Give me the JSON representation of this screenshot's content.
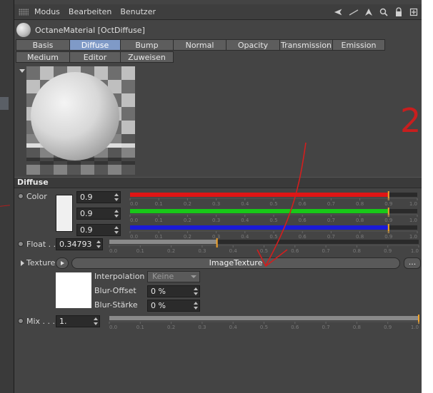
{
  "menubar": {
    "items": [
      "Modus",
      "Bearbeiten",
      "Benutzer"
    ]
  },
  "material": {
    "title": "OctaneMaterial [OctDiffuse]"
  },
  "tabs_row1": [
    {
      "label": "Basis"
    },
    {
      "label": "Diffuse",
      "active": true
    },
    {
      "label": "Bump"
    },
    {
      "label": "Normal"
    },
    {
      "label": "Opacity"
    },
    {
      "label": "Transmission"
    },
    {
      "label": "Emission"
    }
  ],
  "tabs_row2": [
    {
      "label": "Medium"
    },
    {
      "label": "Editor"
    },
    {
      "label": "Zuweisen"
    }
  ],
  "section": {
    "title": "Diffuse"
  },
  "color": {
    "label": "Color",
    "channels": [
      {
        "value": "0.9",
        "level": 0.9,
        "fill": "#e01515"
      },
      {
        "value": "0.9",
        "level": 0.9,
        "fill": "#18c818"
      },
      {
        "value": "0.9",
        "level": 0.9,
        "fill": "#1a1ad6"
      }
    ]
  },
  "float": {
    "label": "Float . .",
    "value": "0.34793",
    "level": 0.34793
  },
  "texture": {
    "label": "Texture",
    "button": "ImageTexture",
    "more": "..."
  },
  "image_settings": {
    "interpolation_label": "Interpolation",
    "interpolation_value": "Keine",
    "blur_offset_label": "Blur-Offset",
    "blur_offset_value": "0 %",
    "blur_strength_label": "Blur-Stärke",
    "blur_strength_value": "0 %"
  },
  "mix": {
    "label": "Mix . . .",
    "value": "1.",
    "level": 1.0
  },
  "slider_ticks": [
    "0.0",
    "0.1",
    "0.2",
    "0.3",
    "0.4",
    "0.5",
    "0.6",
    "0.7",
    "0.8",
    "0.9",
    "1.0"
  ],
  "annotation": {
    "number": "2"
  }
}
